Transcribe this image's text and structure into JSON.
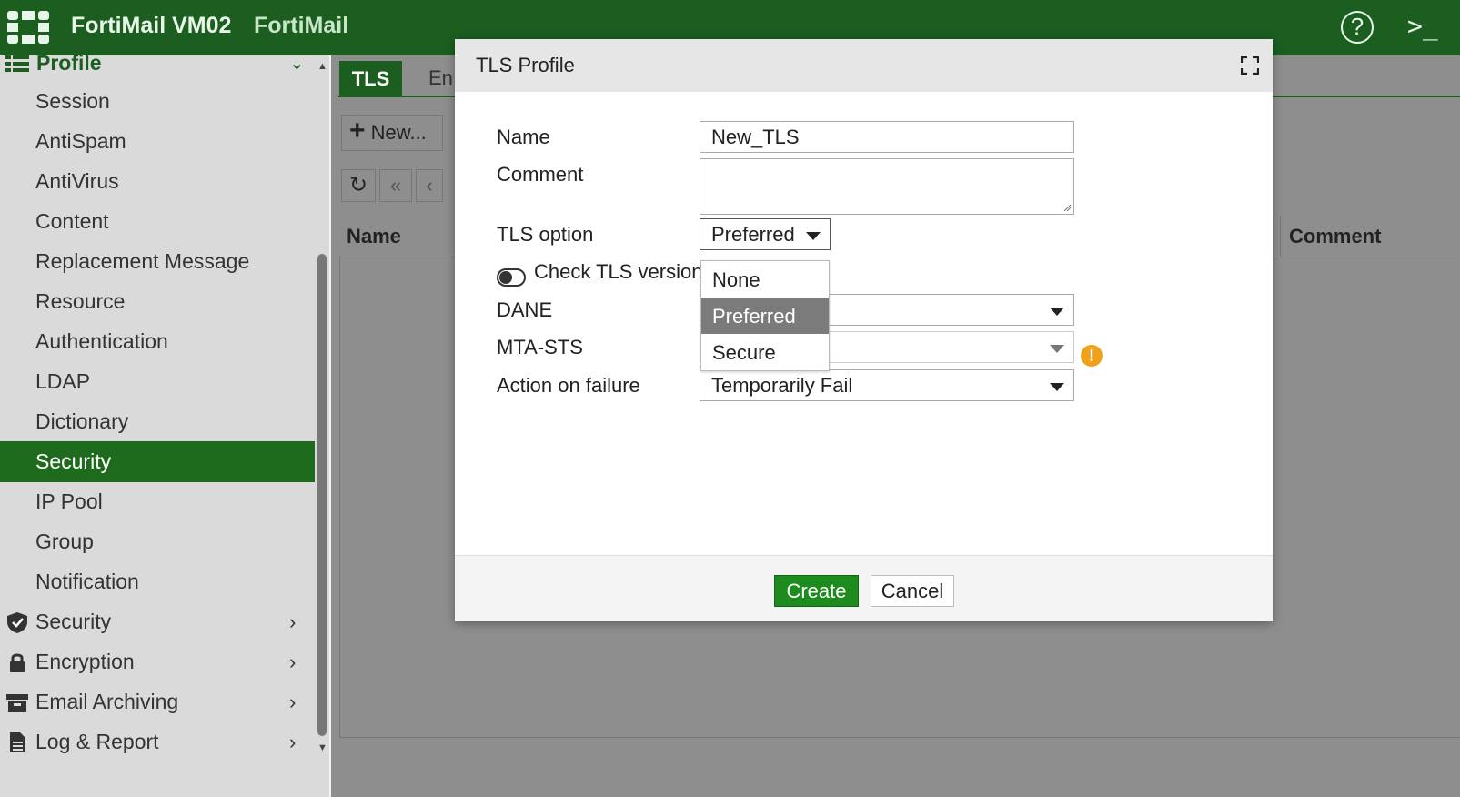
{
  "topbar": {
    "title": "FortiMail VM02",
    "subtitle": "FortiMail",
    "help_icon": "?",
    "cli_icon": ">_"
  },
  "sidebar": {
    "profile_label": "Profile",
    "items": [
      {
        "label": "Session"
      },
      {
        "label": "AntiSpam"
      },
      {
        "label": "AntiVirus"
      },
      {
        "label": "Content"
      },
      {
        "label": "Replacement Message"
      },
      {
        "label": "Resource"
      },
      {
        "label": "Authentication"
      },
      {
        "label": "LDAP"
      },
      {
        "label": "Dictionary"
      },
      {
        "label": "Security"
      },
      {
        "label": "IP Pool"
      },
      {
        "label": "Group"
      },
      {
        "label": "Notification"
      }
    ],
    "sections": [
      {
        "label": "Security",
        "icon": "shield-icon"
      },
      {
        "label": "Encryption",
        "icon": "lock-icon"
      },
      {
        "label": "Email Archiving",
        "icon": "archive-icon"
      },
      {
        "label": "Log & Report",
        "icon": "document-icon"
      }
    ]
  },
  "main": {
    "tabs": [
      "TLS",
      "En"
    ],
    "new_button": "New...",
    "columns": [
      "Name",
      "Comment"
    ]
  },
  "modal": {
    "title": "TLS Profile",
    "name_label": "Name",
    "name_value": "New_TLS",
    "comment_label": "Comment",
    "comment_value": "",
    "tls_option_label": "TLS option",
    "tls_option_value": "Preferred",
    "tls_options": [
      "None",
      "Preferred",
      "Secure"
    ],
    "check_tls_label": "Check TLS version",
    "dane_label": "DANE",
    "mta_sts_label": "MTA-STS",
    "action_label": "Action on failure",
    "action_value": "Temporarily Fail",
    "create_label": "Create",
    "cancel_label": "Cancel"
  },
  "colors": {
    "brand_green": "#1b5e20",
    "create_green": "#1e8b1e",
    "warning": "#f0a11a"
  }
}
